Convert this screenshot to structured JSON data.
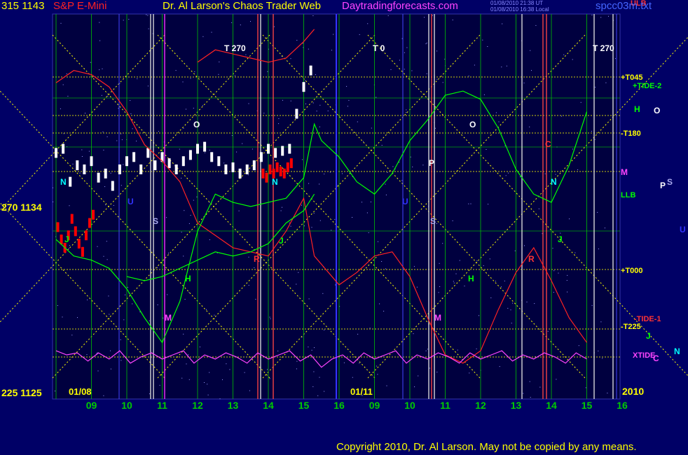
{
  "header": {
    "left_prices": "315  1143",
    "instrument": "S&P E-Mini",
    "title": "Dr. Al Larson's Chaos Trader Web",
    "site": "Daytradingforecasts.com",
    "info_line1": "01/08/2010 21:38 UT",
    "info_line2": "01/08/2010 16:38 Local",
    "file": "spcc03m.txt"
  },
  "footer": {
    "copyright": "Copyright 2010, Dr. Al Larson. May not be copied by any means."
  },
  "colors": {
    "background": "#000066",
    "grid_green": "#00cc00",
    "flux_yellow": "#ffff00",
    "price_white": "#ffffff",
    "price_red": "#ff0000",
    "electric_green": "#00ff00",
    "electric_red": "#ff2222",
    "xtide_magenta": "#ff44ff",
    "cycle_white": "#dddddd",
    "cycle_red": "#ff4444",
    "cycle_blue": "#4444ff",
    "cycle_magenta": "#ff33ff"
  },
  "chart_data": {
    "type": "line",
    "title": "S&P E-Mini",
    "y_left_labels": [
      {
        "text": "315  1143",
        "value": 1143
      },
      {
        "text": "270  1134",
        "value": 1134
      },
      {
        "text": "225  1125",
        "value": 1125
      }
    ],
    "ylim": [
      1125,
      1143
    ],
    "x_ticks": [
      "09",
      "10",
      "11",
      "12",
      "13",
      "14",
      "15",
      "16",
      "09",
      "10",
      "11",
      "12",
      "13",
      "14",
      "15",
      "16"
    ],
    "date_labels": [
      "01/08",
      "01/11"
    ],
    "year_label": "2010",
    "flux_labels": [
      {
        "text": "+T045",
        "color": "#ffff00"
      },
      {
        "text": "+TIDE-2",
        "color": "#00ff00"
      },
      {
        "text": "-T180",
        "color": "#ffff00"
      },
      {
        "text": "LLB",
        "color": "#00ff00"
      },
      {
        "text": "+T000",
        "color": "#ffff00"
      },
      {
        "text": "-TIDE-1",
        "color": "#ff3333"
      },
      {
        "text": "-T225",
        "color": "#ffff00"
      },
      {
        "text": "XTIDE",
        "color": "#ff44ff"
      },
      {
        "text": "ULB",
        "color": "#ff3333"
      }
    ],
    "right_letters": [
      {
        "text": "H",
        "color": "#00ff00"
      },
      {
        "text": "O",
        "color": "#ffffff"
      },
      {
        "text": "M",
        "color": "#ff44ff"
      },
      {
        "text": "P",
        "color": "#ffffff"
      },
      {
        "text": "S",
        "color": "#aaaaee"
      },
      {
        "text": "U",
        "color": "#3333ff"
      },
      {
        "text": "J",
        "color": "#00ff00"
      },
      {
        "text": "N",
        "color": "#00ffff"
      },
      {
        "text": "C",
        "color": "#ff44ff"
      }
    ],
    "chart_annotations": [
      {
        "text": "T  270",
        "color": "#ffffff"
      },
      {
        "text": "T  0",
        "color": "#ffffff"
      },
      {
        "text": "T  270",
        "color": "#ffffff"
      },
      {
        "text": "O",
        "color": "#ffffff"
      },
      {
        "text": "O",
        "color": "#ffffff"
      },
      {
        "text": "P",
        "color": "#ffffff"
      },
      {
        "text": "N",
        "color": "#00ffff"
      },
      {
        "text": "N",
        "color": "#00ffff"
      },
      {
        "text": "N",
        "color": "#00ffff"
      },
      {
        "text": "U",
        "color": "#3333ff"
      },
      {
        "text": "U",
        "color": "#3333ff"
      },
      {
        "text": "S",
        "color": "#aaaaee"
      },
      {
        "text": "S",
        "color": "#aaaaee"
      },
      {
        "text": "J",
        "color": "#00ff00"
      },
      {
        "text": "J",
        "color": "#00ff00"
      },
      {
        "text": "J",
        "color": "#00ff00"
      },
      {
        "text": "R",
        "color": "#ff3333"
      },
      {
        "text": "R",
        "color": "#ff3333"
      },
      {
        "text": "H",
        "color": "#00ff00"
      },
      {
        "text": "H",
        "color": "#00ff00"
      },
      {
        "text": "M",
        "color": "#ff44ff"
      },
      {
        "text": "M",
        "color": "#ff44ff"
      },
      {
        "text": "C",
        "color": "#ff3333"
      }
    ],
    "series": [
      {
        "kind": "price_bars",
        "color": "#ffffff",
        "x": [
          0,
          0.2,
          0.4,
          0.6,
          0.8,
          1.0,
          1.2,
          1.4,
          1.6,
          1.8,
          2.0,
          2.2,
          2.4,
          2.6,
          2.8,
          3.0,
          3.2,
          3.4,
          3.6,
          3.8,
          4.0,
          4.2,
          4.4,
          4.6,
          4.8,
          5.0,
          5.2,
          5.4,
          5.6,
          5.8,
          6.0,
          6.2,
          6.4,
          6.6,
          6.8,
          7.0,
          7.2
        ],
        "y": [
          1136.6,
          1136.8,
          1135.2,
          1136.0,
          1135.8,
          1136.2,
          1135.4,
          1135.6,
          1135.0,
          1135.8,
          1136.2,
          1136.4,
          1135.8,
          1136.6,
          1136.0,
          1136.4,
          1136.1,
          1135.8,
          1136.2,
          1136.5,
          1136.8,
          1136.9,
          1136.4,
          1136.2,
          1135.8,
          1135.9,
          1135.6,
          1135.8,
          1136.0,
          1136.4,
          1136.8,
          1136.6,
          1136.7,
          1136.8,
          1138.5,
          1139.8,
          1140.6
        ]
      },
      {
        "kind": "price_bars",
        "color": "#ff0000",
        "x": [
          0.05,
          0.15,
          0.25,
          0.35,
          0.45,
          0.55,
          0.65,
          0.75,
          0.85,
          0.95,
          1.05,
          5.85,
          5.95,
          6.05,
          6.15,
          6.25,
          6.35,
          6.45,
          6.55,
          6.65
        ],
        "y": [
          1133.0,
          1132.4,
          1132.0,
          1132.6,
          1133.4,
          1132.8,
          1132.2,
          1131.8,
          1132.6,
          1133.2,
          1133.6,
          1135.6,
          1135.4,
          1135.8,
          1135.6,
          1135.9,
          1135.7,
          1135.6,
          1135.9,
          1136.1
        ]
      },
      {
        "kind": "electric_red",
        "color": "#ff2222",
        "x": [
          0,
          0.5,
          1,
          1.5,
          2,
          2.5,
          3,
          3.5,
          4,
          4.5,
          5,
          5.5,
          6,
          6.5,
          7,
          7.3,
          8,
          8.5,
          9,
          9.5,
          10,
          10.5,
          11,
          11.5,
          12,
          12.5,
          13,
          13.5,
          14,
          14.5,
          15
        ],
        "y": [
          1140.0,
          1140.6,
          1140.4,
          1139.8,
          1138.6,
          1137.0,
          1136.2,
          1135.2,
          1133.2,
          1132.6,
          1132.0,
          1131.8,
          1131.6,
          1132.8,
          1134.4,
          1131.6,
          1130.2,
          1130.8,
          1131.6,
          1131.8,
          1130.6,
          1128.6,
          1126.8,
          1126.4,
          1127.0,
          1129.0,
          1130.8,
          1132.0,
          1130.4,
          1128.6,
          1127.4
        ]
      },
      {
        "kind": "electric_red",
        "color": "#ff2222",
        "x": [
          4.0,
          4.5,
          5.0,
          5.5,
          6.0,
          6.5,
          7.0,
          7.3
        ],
        "y": [
          1141.0,
          1141.6,
          1141.4,
          1141.2,
          1141.0,
          1141.2,
          1142.0,
          1142.6
        ]
      },
      {
        "kind": "electric_green",
        "color": "#00ff00",
        "x": [
          0,
          0.5,
          1,
          1.5,
          2,
          2.5,
          3,
          3.5,
          4,
          4.5,
          5,
          5.5,
          6,
          6.5,
          7,
          7.3,
          7.5,
          8,
          8.5,
          9,
          9.5,
          10,
          10.5,
          11,
          11.5,
          12,
          12.5,
          13,
          13.5,
          14,
          14.5,
          15
        ],
        "y": [
          1132.4,
          1131.6,
          1131.4,
          1131.0,
          1130.0,
          1128.6,
          1127.4,
          1129.4,
          1132.8,
          1134.6,
          1134.2,
          1134.0,
          1134.2,
          1134.4,
          1135.4,
          1138.0,
          1137.2,
          1136.4,
          1135.2,
          1134.6,
          1135.6,
          1137.2,
          1138.2,
          1139.4,
          1139.6,
          1139.2,
          1137.8,
          1135.8,
          1134.6,
          1134.2,
          1136.0,
          1138.6
        ]
      },
      {
        "kind": "electric_green",
        "color": "#00ff00",
        "x": [
          2.0,
          2.5,
          3.0,
          3.5,
          4.0,
          4.5,
          5.0,
          5.5,
          6.0,
          6.5,
          7.0,
          7.3
        ],
        "y": [
          1130.6,
          1130.4,
          1130.6,
          1131.0,
          1131.4,
          1131.8,
          1131.6,
          1131.8,
          1132.2,
          1133.2,
          1133.8,
          1134.6
        ]
      },
      {
        "kind": "xtide",
        "color": "#ff44ff",
        "x": [
          0,
          0.3,
          0.6,
          0.9,
          1.2,
          1.5,
          1.8,
          2.1,
          2.4,
          2.7,
          3.0,
          3.3,
          3.6,
          3.9,
          4.2,
          4.5,
          4.8,
          5.1,
          5.4,
          5.7,
          6.0,
          6.3,
          6.6,
          6.9,
          7.2,
          7.5,
          7.8,
          8.1,
          8.4,
          8.7,
          9.0,
          9.3,
          9.6,
          9.9,
          10.2,
          10.5,
          10.8,
          11.1,
          11.4,
          11.7,
          12.0,
          12.3,
          12.6,
          12.9,
          13.2,
          13.5,
          13.8,
          14.1,
          14.4,
          14.7,
          15.0
        ],
        "y": [
          1127.0,
          1126.8,
          1126.9,
          1126.5,
          1126.9,
          1126.6,
          1127.0,
          1126.4,
          1126.7,
          1126.9,
          1126.6,
          1126.8,
          1127.0,
          1126.4,
          1126.8,
          1126.6,
          1126.9,
          1126.7,
          1126.4,
          1126.9,
          1126.6,
          1126.8,
          1127.0,
          1126.5,
          1126.8,
          1126.2,
          1126.6,
          1126.8,
          1126.4,
          1126.9,
          1126.6,
          1126.8,
          1127.0,
          1126.4,
          1126.8,
          1126.6,
          1126.9,
          1126.7,
          1126.4,
          1126.9,
          1126.6,
          1126.8,
          1127.0,
          1126.5,
          1126.8,
          1126.6,
          1126.9,
          1126.7,
          1126.4,
          1126.9,
          1126.6
        ]
      }
    ]
  }
}
